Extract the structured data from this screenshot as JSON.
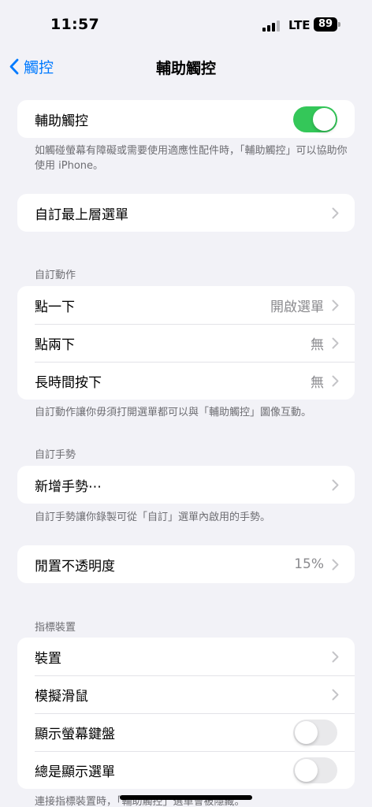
{
  "status": {
    "time": "11:57",
    "network": "LTE",
    "battery": "89"
  },
  "nav": {
    "back_label": "觸控",
    "title": "輔助觸控"
  },
  "main_toggle": {
    "label": "輔助觸控",
    "on": true
  },
  "main_footer": "如觸碰螢幕有障礙或需要使用適應性配件時，「輔助觸控」可以協助你使用 iPhone。",
  "top_menu": {
    "label": "自訂最上層選單"
  },
  "custom_actions": {
    "header": "自訂動作",
    "items": [
      {
        "label": "點一下",
        "value": "開啟選單"
      },
      {
        "label": "點兩下",
        "value": "無"
      },
      {
        "label": "長時間按下",
        "value": "無"
      }
    ],
    "footer": "自訂動作讓你毋須打開選單都可以與「輔助觸控」圖像互動。"
  },
  "custom_gestures": {
    "header": "自訂手勢",
    "new_label": "新增手勢⋯",
    "footer": "自訂手勢讓你錄製可從「自訂」選單內啟用的手勢。"
  },
  "idle_opacity": {
    "label": "閒置不透明度",
    "value": "15%"
  },
  "pointer_devices": {
    "header": "指標裝置",
    "devices_label": "裝置",
    "mouse_keys_label": "模擬滑鼠",
    "show_keyboard": {
      "label": "顯示螢幕鍵盤",
      "on": false
    },
    "always_show_menu": {
      "label": "總是顯示選單",
      "on": false
    },
    "footer": "連接指標裝置時，「輔助觸控」選單會被隱藏。"
  },
  "colors": {
    "accent": "#007aff",
    "toggle_on": "#34c759",
    "background": "#f2f2f7"
  }
}
